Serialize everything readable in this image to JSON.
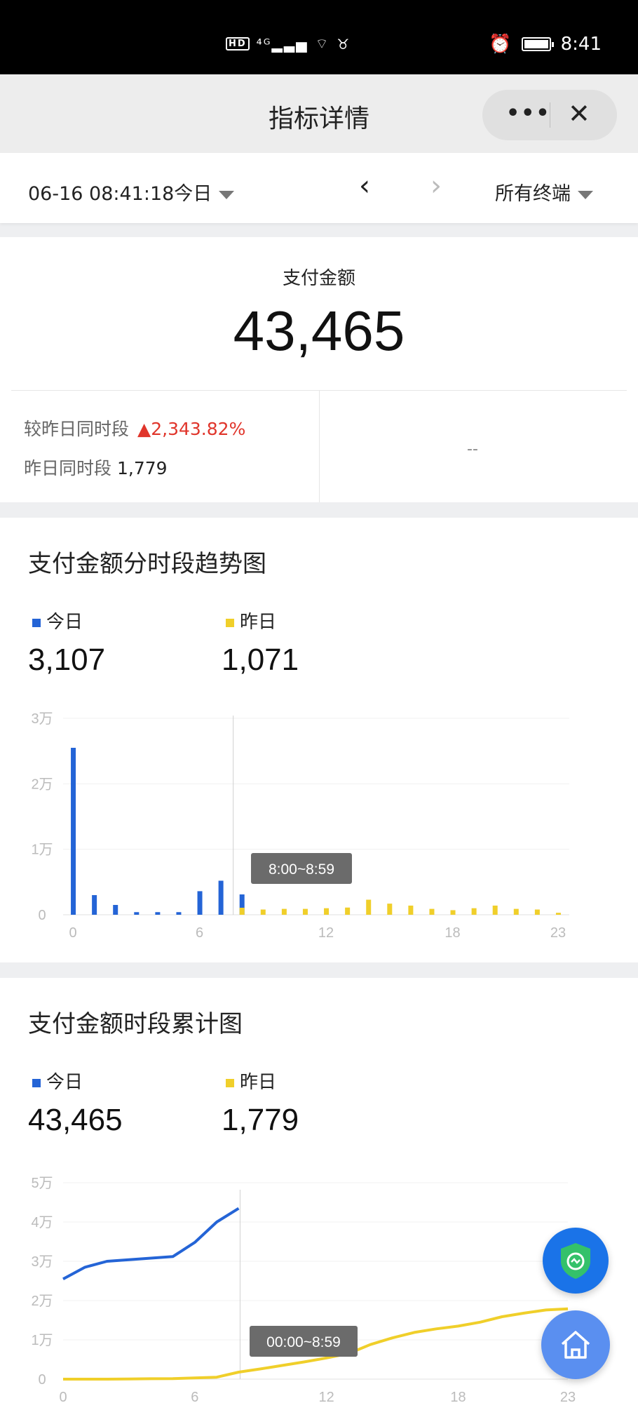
{
  "status_bar": {
    "network": "HD 4G",
    "time": "8:41"
  },
  "nav": {
    "title": "指标详情",
    "more": "•••",
    "close": "✕"
  },
  "filter": {
    "date": "06-16 08:41:18今日",
    "prev": "‹",
    "next": "›",
    "terminal": "所有终端"
  },
  "kpi": {
    "label": "支付金额",
    "value": "43,465",
    "compare_label": "较昨日同时段",
    "compare_value": "▲2,343.82%",
    "yesterday_label": "昨日同时段",
    "yesterday_value": "1,779",
    "placeholder": "--"
  },
  "colors": {
    "today": "#2464d6",
    "yesterday": "#f0cf2a",
    "up": "#e0352b"
  },
  "hourly": {
    "title": "支付金额分时段趋势图",
    "legend_today": "今日",
    "legend_yesterday": "昨日",
    "today_value": "3,107",
    "yesterday_value": "1,071",
    "tooltip": "8:00~8:59"
  },
  "cumulative": {
    "title": "支付金额时段累计图",
    "legend_today": "今日",
    "legend_yesterday": "昨日",
    "today_value": "43,465",
    "yesterday_value": "1,779",
    "tooltip": "00:00~8:59"
  },
  "chart_data": [
    {
      "type": "bar",
      "title": "支付金额分时段趋势图",
      "x": [
        0,
        1,
        2,
        3,
        4,
        5,
        6,
        7,
        8,
        9,
        10,
        11,
        12,
        13,
        14,
        15,
        16,
        17,
        18,
        19,
        20,
        21,
        22,
        23
      ],
      "x_ticks": [
        "0",
        "6",
        "12",
        "18",
        "23"
      ],
      "y_ticks": [
        "0",
        "1万",
        "2万",
        "3万"
      ],
      "ylim": [
        0,
        30000
      ],
      "grid": true,
      "series": [
        {
          "name": "今日",
          "values": [
            25500,
            3000,
            1500,
            400,
            400,
            400,
            3600,
            5200,
            3107,
            null,
            null,
            null,
            null,
            null,
            null,
            null,
            null,
            null,
            null,
            null,
            null,
            null,
            null,
            null
          ]
        },
        {
          "name": "昨日",
          "values": [
            null,
            null,
            null,
            null,
            null,
            null,
            null,
            null,
            1071,
            800,
            900,
            900,
            1000,
            1100,
            2300,
            1700,
            1400,
            900,
            700,
            1000,
            1400,
            900,
            800,
            300
          ]
        }
      ]
    },
    {
      "type": "line",
      "title": "支付金额时段累计图",
      "x": [
        0,
        1,
        2,
        3,
        4,
        5,
        6,
        7,
        8,
        9,
        10,
        11,
        12,
        13,
        14,
        15,
        16,
        17,
        18,
        19,
        20,
        21,
        22,
        23
      ],
      "x_ticks": [
        "0",
        "6",
        "12",
        "18",
        "23"
      ],
      "y_ticks": [
        "0",
        "1万",
        "2万",
        "3万",
        "4万",
        "5万"
      ],
      "ylim": [
        0,
        50000
      ],
      "grid": true,
      "series": [
        {
          "name": "今日",
          "values": [
            25500,
            28500,
            30000,
            30400,
            30800,
            31200,
            34800,
            40000,
            43465,
            null,
            null,
            null,
            null,
            null,
            null,
            null,
            null,
            null,
            null,
            null,
            null,
            null,
            null,
            null
          ]
        },
        {
          "name": "昨日",
          "values": [
            0,
            0,
            0,
            50,
            100,
            150,
            300,
            500,
            1779,
            2600,
            3500,
            4400,
            5400,
            6500,
            8800,
            10500,
            11900,
            12800,
            13500,
            14500,
            15900,
            16800,
            17600,
            17900
          ]
        }
      ]
    }
  ]
}
